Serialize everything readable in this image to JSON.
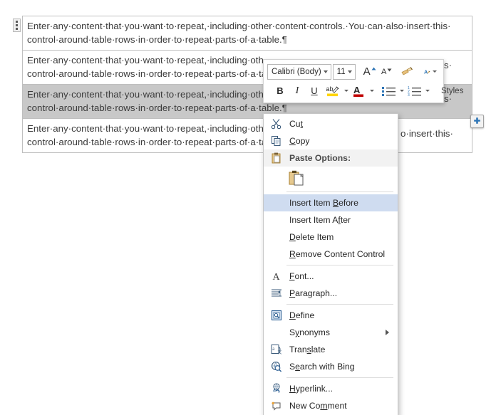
{
  "document": {
    "rows": [
      {
        "line1": "Enter·any·content·that·you·want·to·repeat,·including·other·content·controls.·You·can·also·insert·this·",
        "line2": "control·around·table·rows·in·order·to·repeat·parts·of·a·table.¶",
        "selected": false
      },
      {
        "line1": "Enter·any·content·that·you·want·to·repeat,·including·oth",
        "line2": "control·around·table·rows·in·order·to·repeat·parts·of·a·ta",
        "selected": false
      },
      {
        "line1": "Enter·any·content·that·you·want·to·repeat,·including·oth",
        "line2": "control·around·table·rows·in·order·to·repeat·parts·of·a·table.¶",
        "selected": true
      },
      {
        "line1": "Enter·any·content·that·you·want·to·repeat,·including·oth",
        "line2": "control·around·table·rows·in·order·to·repeat·parts·of·a·ta",
        "selected": false
      }
    ],
    "row1_tail": "is·",
    "row3_tail": "is·",
    "row4_tail": "o·insert·this·",
    "add_row_button_label": "+"
  },
  "mini_toolbar": {
    "font_name": "Calibri (Body)",
    "font_size": "11",
    "grow_font": "A",
    "shrink_font": "A",
    "format_painter_icon": "format-painter-icon",
    "styles_label": "Styles",
    "bold": "B",
    "italic": "I",
    "underline": "U",
    "highlight": "ab",
    "font_color": "A",
    "bullets_icon": "bullet-list-icon",
    "numbering_icon": "numbered-list-icon"
  },
  "context_menu": {
    "items": [
      {
        "id": "cut",
        "label": "Cut",
        "accel": "t",
        "icon": "scissors-icon",
        "type": "item"
      },
      {
        "id": "copy",
        "label": "Copy",
        "accel": "C",
        "icon": "copy-icon",
        "type": "item"
      },
      {
        "id": "paste-options",
        "label": "Paste Options:",
        "accel": "",
        "icon": "clipboard-icon",
        "type": "header"
      },
      {
        "id": "paste-gallery",
        "label": "",
        "accel": "",
        "icon": "paste-keep-source-formatting-icon",
        "type": "gallery"
      },
      {
        "id": "sep1",
        "type": "separator"
      },
      {
        "id": "insert-item-before",
        "label": "Insert Item Before",
        "accel": "B",
        "icon": "",
        "type": "item",
        "highlighted": true
      },
      {
        "id": "insert-item-after",
        "label": "Insert Item After",
        "accel": "f",
        "icon": "",
        "type": "item"
      },
      {
        "id": "delete-item",
        "label": "Delete Item",
        "accel": "D",
        "icon": "",
        "type": "item"
      },
      {
        "id": "remove-content-control",
        "label": "Remove Content Control",
        "accel": "R",
        "icon": "",
        "type": "item"
      },
      {
        "id": "sep2",
        "type": "separator"
      },
      {
        "id": "font",
        "label": "Font...",
        "accel": "F",
        "icon": "font-a-icon",
        "type": "item"
      },
      {
        "id": "paragraph",
        "label": "Paragraph...",
        "accel": "P",
        "icon": "paragraph-icon",
        "type": "item"
      },
      {
        "id": "sep3",
        "type": "separator"
      },
      {
        "id": "define",
        "label": "Define",
        "accel": "D",
        "icon": "define-book-icon",
        "type": "item"
      },
      {
        "id": "synonyms",
        "label": "Synonyms",
        "accel": "y",
        "icon": "",
        "type": "submenu"
      },
      {
        "id": "translate",
        "label": "Translate",
        "accel": "s",
        "icon": "translate-icon",
        "type": "item"
      },
      {
        "id": "search-with-bing",
        "label": "Search with Bing",
        "accel": "e",
        "icon": "search-globe-icon",
        "type": "item"
      },
      {
        "id": "sep4",
        "type": "separator"
      },
      {
        "id": "hyperlink",
        "label": "Hyperlink...",
        "accel": "H",
        "icon": "hyperlink-icon",
        "type": "item"
      },
      {
        "id": "new-comment",
        "label": "New Comment",
        "accel": "m",
        "icon": "new-comment-icon",
        "type": "item"
      }
    ]
  },
  "colors": {
    "selection_gray": "#c8c8c8",
    "menu_highlight": "#cfdcf0",
    "accent_blue": "#2e75b6",
    "highlight_yellow": "#ffd500",
    "font_color_red": "#c00000",
    "table_border": "#bfbfbf"
  }
}
